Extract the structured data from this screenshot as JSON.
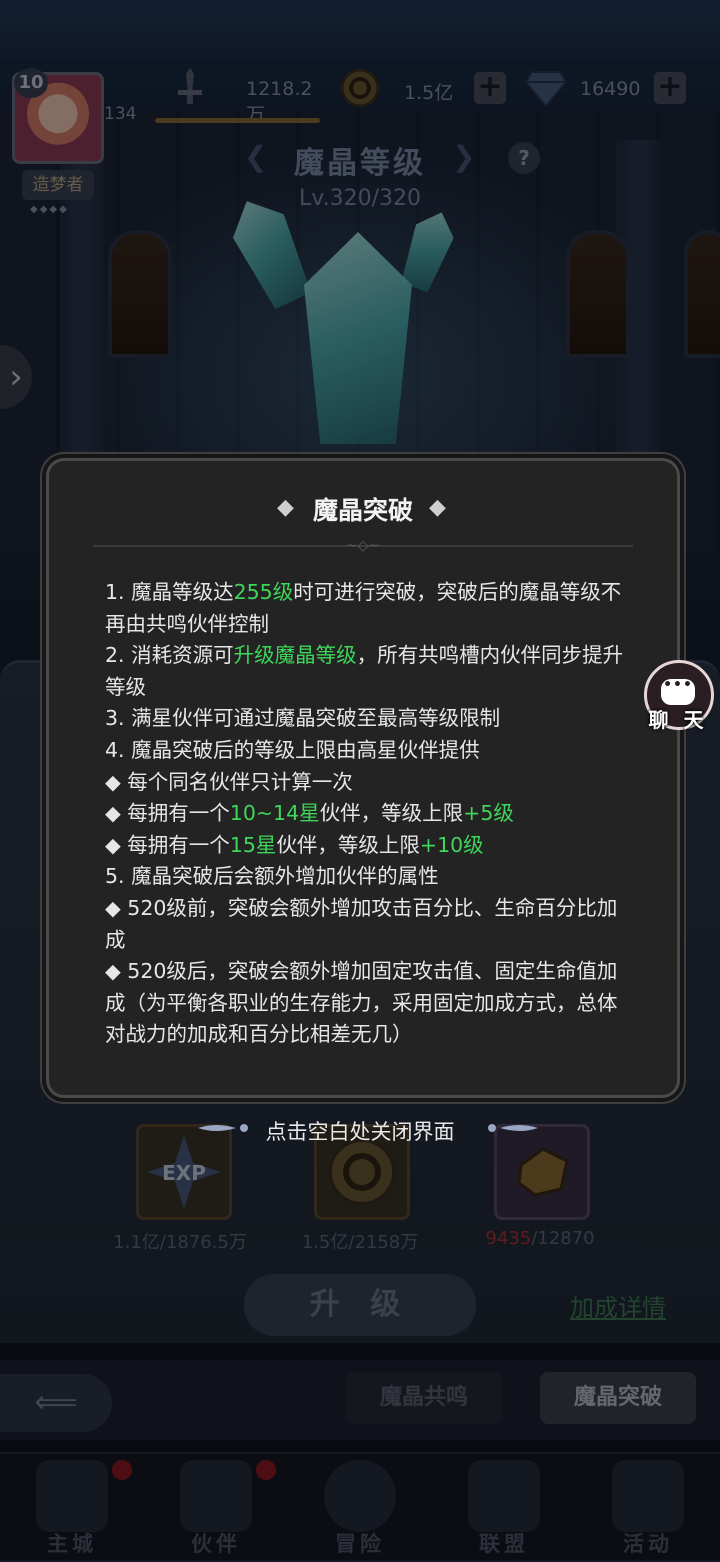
{
  "hud": {
    "player_level": "10",
    "power": "134",
    "title": "造梦者",
    "combat_power": "1218.2万",
    "gold": "1.5亿",
    "diamonds": "16490",
    "plus_label": "+"
  },
  "header": {
    "title": "魔晶等级",
    "level": "Lv.320/320",
    "help_label": "?"
  },
  "modal": {
    "title": "魔晶突破",
    "lines": [
      {
        "parts": [
          {
            "t": "1. 魔晶等级达"
          },
          {
            "t": "255级",
            "g": true
          },
          {
            "t": "时可进行突破，突破后的魔晶等级不再由共鸣伙伴控制"
          }
        ]
      },
      {
        "parts": [
          {
            "t": "2. 消耗资源可"
          },
          {
            "t": "升级魔晶等级",
            "g": true
          },
          {
            "t": "，所有共鸣槽内伙伴同步提升等级"
          }
        ]
      },
      {
        "parts": [
          {
            "t": "3. 满星伙伴可通过魔晶突破至最高等级限制"
          }
        ]
      },
      {
        "parts": [
          {
            "t": "4. 魔晶突破后的等级上限由高星伙伴提供"
          }
        ]
      },
      {
        "parts": [
          {
            "t": "◆ 每个同名伙伴只计算一次"
          }
        ]
      },
      {
        "parts": [
          {
            "t": "◆ 每拥有一个"
          },
          {
            "t": "10~14星",
            "g": true
          },
          {
            "t": "伙伴，等级上限"
          },
          {
            "t": "+5级",
            "g": true
          }
        ]
      },
      {
        "parts": [
          {
            "t": "◆ 每拥有一个"
          },
          {
            "t": "15星",
            "g": true
          },
          {
            "t": "伙伴，等级上限"
          },
          {
            "t": "+10级",
            "g": true
          }
        ]
      },
      {
        "parts": [
          {
            "t": "5. 魔晶突破后会额外增加伙伴的属性"
          }
        ]
      },
      {
        "parts": [
          {
            "t": "◆ 520级前，突破会额外增加攻击百分比、生命百分比加成"
          }
        ]
      },
      {
        "parts": [
          {
            "t": "◆ 520级后，突破会额外增加固定攻击值、固定生命值加成（为平衡各职业的生存能力，采用固定加成方式，总体对战力的加成和百分比相差无几）"
          }
        ]
      }
    ],
    "close_hint": "点击空白处关闭界面"
  },
  "materials": [
    {
      "icon": "exp-icon",
      "have": "1.1亿",
      "need": "/1876.5万",
      "short": false
    },
    {
      "icon": "gold-coin-icon",
      "have": "1.5亿",
      "need": "/2158万",
      "short": false
    },
    {
      "icon": "ore-icon",
      "have": "9435",
      "need": "/12870",
      "short": true
    }
  ],
  "actions": {
    "upgrade": "升 级",
    "bonus_details": "加成详情"
  },
  "tabs": {
    "resonance": "魔晶共鸣",
    "breakthrough": "魔晶突破"
  },
  "chat": {
    "label": "聊 天"
  },
  "nav": [
    {
      "label": "主城",
      "badge": true
    },
    {
      "label": "伙伴",
      "badge": true
    },
    {
      "label": "冒险",
      "badge": false
    },
    {
      "label": "联盟",
      "badge": false
    },
    {
      "label": "活动",
      "badge": false
    }
  ],
  "colors": {
    "highlight_green": "#3ed65a",
    "short_red": "#a8343a"
  }
}
